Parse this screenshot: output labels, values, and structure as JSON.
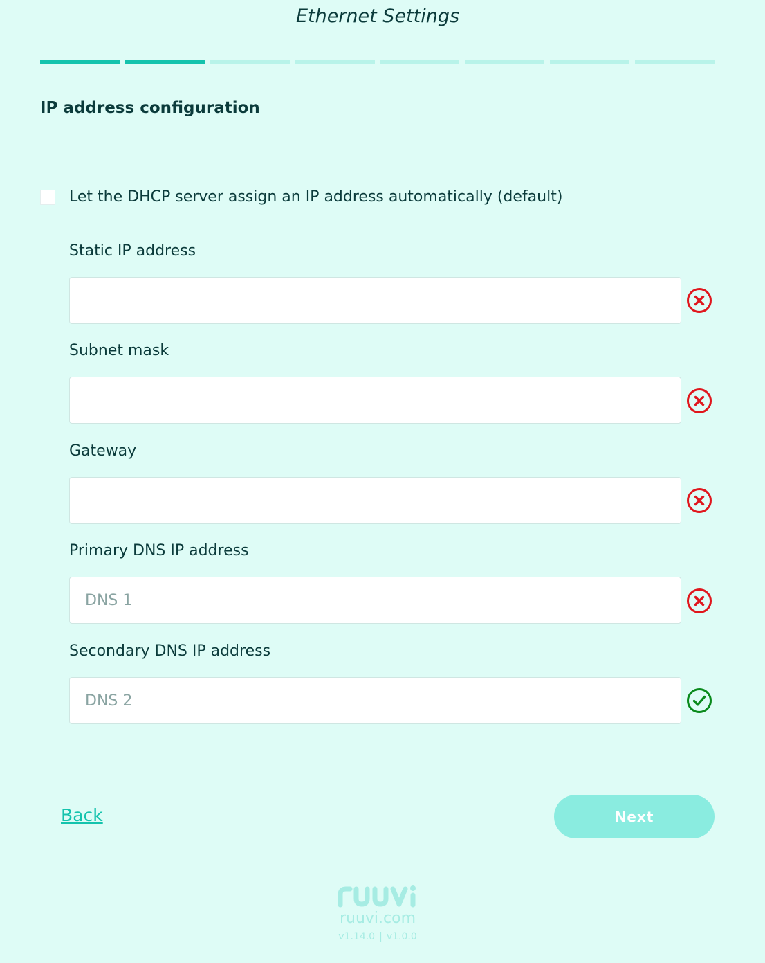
{
  "header": {
    "title": "Ethernet Settings"
  },
  "progress": {
    "total_steps": 8,
    "completed_steps": 2,
    "colors": {
      "done": "#14c3ad",
      "pending": "#b8f3e9"
    }
  },
  "section": {
    "title": "IP address configuration"
  },
  "dhcp": {
    "label": "Let the DHCP server assign an IP address automatically (default)",
    "checked": false
  },
  "fields": [
    {
      "label": "Static IP address",
      "value": "",
      "placeholder": "",
      "status": "invalid"
    },
    {
      "label": "Subnet mask",
      "value": "",
      "placeholder": "",
      "status": "invalid"
    },
    {
      "label": "Gateway",
      "value": "",
      "placeholder": "",
      "status": "invalid"
    },
    {
      "label": "Primary DNS IP address",
      "value": "",
      "placeholder": "DNS 1",
      "status": "invalid"
    },
    {
      "label": "Secondary DNS IP address",
      "value": "",
      "placeholder": "DNS 2",
      "status": "valid"
    }
  ],
  "status_colors": {
    "invalid": "#e0161d",
    "valid": "#0a8a1c"
  },
  "nav": {
    "back_label": "Back",
    "next_label": "Next"
  },
  "footer": {
    "brand": "ruuvi",
    "site": "ruuvi.com",
    "version_fw": "v1.14.0",
    "version_ui": "v1.0.0"
  }
}
